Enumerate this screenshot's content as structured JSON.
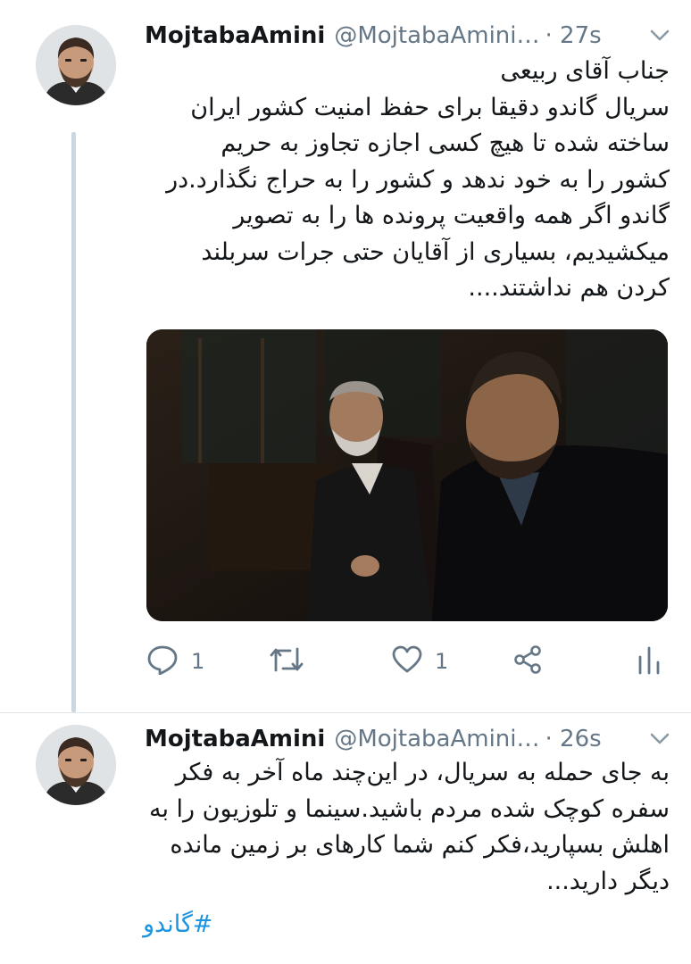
{
  "tweets": [
    {
      "name": "MojtabaAmini",
      "handle": "@MojtabaAmini…",
      "time": "· 27s",
      "lines": [
        "جناب آقای ربیعی",
        "سریال گاندو دقیقا برای حفظ امنیت کشور ایران",
        "ساخته شده تا هیچ کسی اجازه تجاوز به حریم",
        "کشور را به خود ندهد و کشور را به حراج نگذارد.در",
        "گاندو اگر همه واقعیت پرونده ها را به تصویر",
        "میکشیدیم، بسیاری از آقایان حتی جرات سربلند",
        "کردن هم نداشتند...."
      ],
      "reply_count": "1",
      "like_count": "1"
    },
    {
      "name": "MojtabaAmini",
      "handle": "@MojtabaAmini…",
      "time": "· 26s",
      "lines": [
        "به جای حمله به سریال، در این‌چند ماه آخر به فکر",
        "سفره کوچک شده مردم باشید.سینما و تلوزیون را به",
        "اهلش بسپارید،فکر کنم شما کارهای بر زمین مانده",
        "دیگر دارید..."
      ],
      "hashtag": "#گاندو"
    }
  ],
  "icons": {
    "reply": "reply-icon",
    "retweet": "retweet-icon",
    "like": "heart-icon",
    "share": "share-icon",
    "analytics": "analytics-icon",
    "caret": "chevron-down-icon"
  },
  "colors": {
    "text": "#14171a",
    "secondary": "#657786",
    "link": "#1b95e0",
    "thread_line": "#ccd6dd"
  }
}
